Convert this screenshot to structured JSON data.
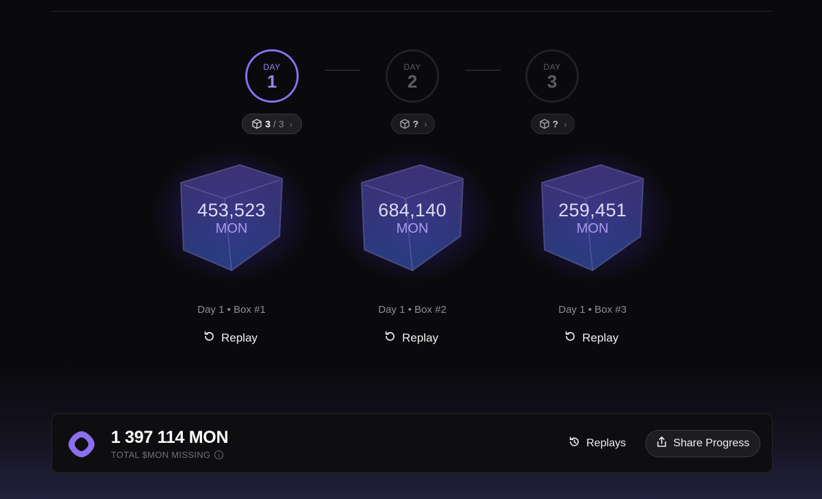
{
  "days": [
    {
      "label": "DAY",
      "number": "1",
      "active": true
    },
    {
      "label": "DAY",
      "number": "2",
      "active": false
    },
    {
      "label": "DAY",
      "number": "3",
      "active": false
    }
  ],
  "pills": [
    {
      "count": "3",
      "separator": "/",
      "total": "3"
    },
    {
      "unknown": "?"
    },
    {
      "unknown": "?"
    }
  ],
  "boxes": [
    {
      "amount": "453,523",
      "unit": "MON",
      "caption": "Day 1 • Box #1",
      "replay_label": "Replay"
    },
    {
      "amount": "684,140",
      "unit": "MON",
      "caption": "Day 1 • Box #2",
      "replay_label": "Replay"
    },
    {
      "amount": "259,451",
      "unit": "MON",
      "caption": "Day 1 • Box #3",
      "replay_label": "Replay"
    }
  ],
  "summary": {
    "total": "1 397 114 MON",
    "label": "TOTAL $MON MISSING",
    "info_icon": "i",
    "replays_label": "Replays",
    "share_label": "Share Progress"
  },
  "icons": {
    "box": "cube-icon",
    "chevron": "chevron-right-icon",
    "replay": "rotate-ccw-icon",
    "history": "history-icon",
    "share": "share-icon",
    "logo": "monad-logo"
  },
  "colors": {
    "accent": "#8a6ff0",
    "background": "#0a0a0c"
  }
}
